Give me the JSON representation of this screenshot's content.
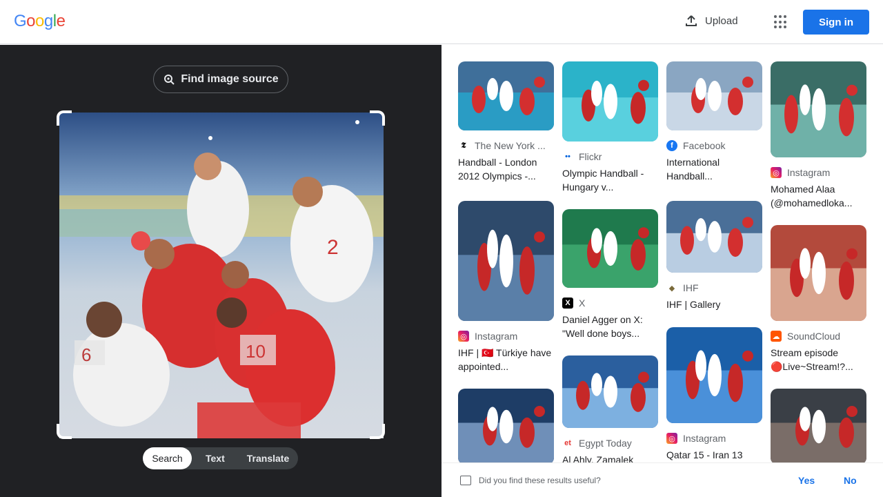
{
  "header": {
    "logo_letters": [
      "G",
      "o",
      "o",
      "g",
      "l",
      "e"
    ],
    "logo_colors": [
      "#4285f4",
      "#ea4335",
      "#fbbc05",
      "#4285f4",
      "#34a853",
      "#ea4335"
    ],
    "upload_label": "Upload",
    "signin_label": "Sign in"
  },
  "left_panel": {
    "find_source_label": "Find image source",
    "modes": [
      "Search",
      "Text",
      "Translate"
    ],
    "active_mode": "Search"
  },
  "results": [
    {
      "source": "The New York ...",
      "source_icon": "nytimes-icon",
      "title": "Handball - London 2012 Olympics -...",
      "thumb_colors": [
        "#3f6f9a",
        "#2a9cc4",
        "#ffffff",
        "#d32f2f"
      ]
    },
    {
      "source": "Flickr",
      "source_icon": "flickr-icon",
      "title": "Olympic Handball - Hungary v...",
      "thumb_colors": [
        "#2bb3c9",
        "#59d0de",
        "#ffffff",
        "#c62828"
      ]
    },
    {
      "source": "Facebook",
      "source_icon": "facebook-icon",
      "title": "International Handball...",
      "thumb_colors": [
        "#8aa6c2",
        "#c9d7e6",
        "#ffffff",
        "#d32f2f"
      ]
    },
    {
      "source": "Instagram",
      "source_icon": "instagram-icon",
      "title": "Mohamed Alaa (@mohamedloka...",
      "thumb_colors": [
        "#3a6d66",
        "#6fb1a8",
        "#ffffff",
        "#d32f2f"
      ]
    },
    {
      "source": "Instagram",
      "source_icon": "instagram-icon",
      "title": "IHF | 🇹🇷 Türkiye have appointed...",
      "thumb_colors": [
        "#2e4a6b",
        "#5a7fa8",
        "#ffffff",
        "#c62828"
      ]
    },
    {
      "source": "X",
      "source_icon": "x-icon",
      "title": "Daniel Agger on X: \"Well done boys...",
      "thumb_colors": [
        "#1f7a4d",
        "#3aa36b",
        "#ffffff",
        "#c62828"
      ]
    },
    {
      "source": "IHF",
      "source_icon": "ihf-icon",
      "title": "IHF | Gallery",
      "thumb_colors": [
        "#4a6f98",
        "#b9cde2",
        "#ffffff",
        "#d32f2f"
      ]
    },
    {
      "source": "SoundCloud",
      "source_icon": "soundcloud-icon",
      "title": "Stream episode 🔴Live~Stream!?...",
      "thumb_colors": [
        "#b34a3c",
        "#d9a58f",
        "#ffffff",
        "#c62828"
      ]
    },
    {
      "source": "",
      "source_icon": "",
      "title": "",
      "thumb_colors": [
        "#1e3d66",
        "#6f8fb8",
        "#ffffff",
        "#c62828"
      ]
    },
    {
      "source": "Egypt Today",
      "source_icon": "egypttoday-icon",
      "title": "Al Ahly, Zamalek",
      "thumb_colors": [
        "#2b5f9e",
        "#7db0e0",
        "#ffffff",
        "#c62828"
      ]
    },
    {
      "source": "Instagram",
      "source_icon": "instagram-icon",
      "title": "Qatar 15 - Iran 13",
      "thumb_colors": [
        "#1b5fa8",
        "#4a90d9",
        "#ffffff",
        "#c62828"
      ]
    },
    {
      "source": "",
      "source_icon": "",
      "title": "",
      "thumb_colors": [
        "#3a3f46",
        "#7a6d68",
        "#ffffff",
        "#c62828"
      ]
    }
  ],
  "feedback": {
    "question": "Did you find these results useful?",
    "yes_label": "Yes",
    "no_label": "No"
  }
}
